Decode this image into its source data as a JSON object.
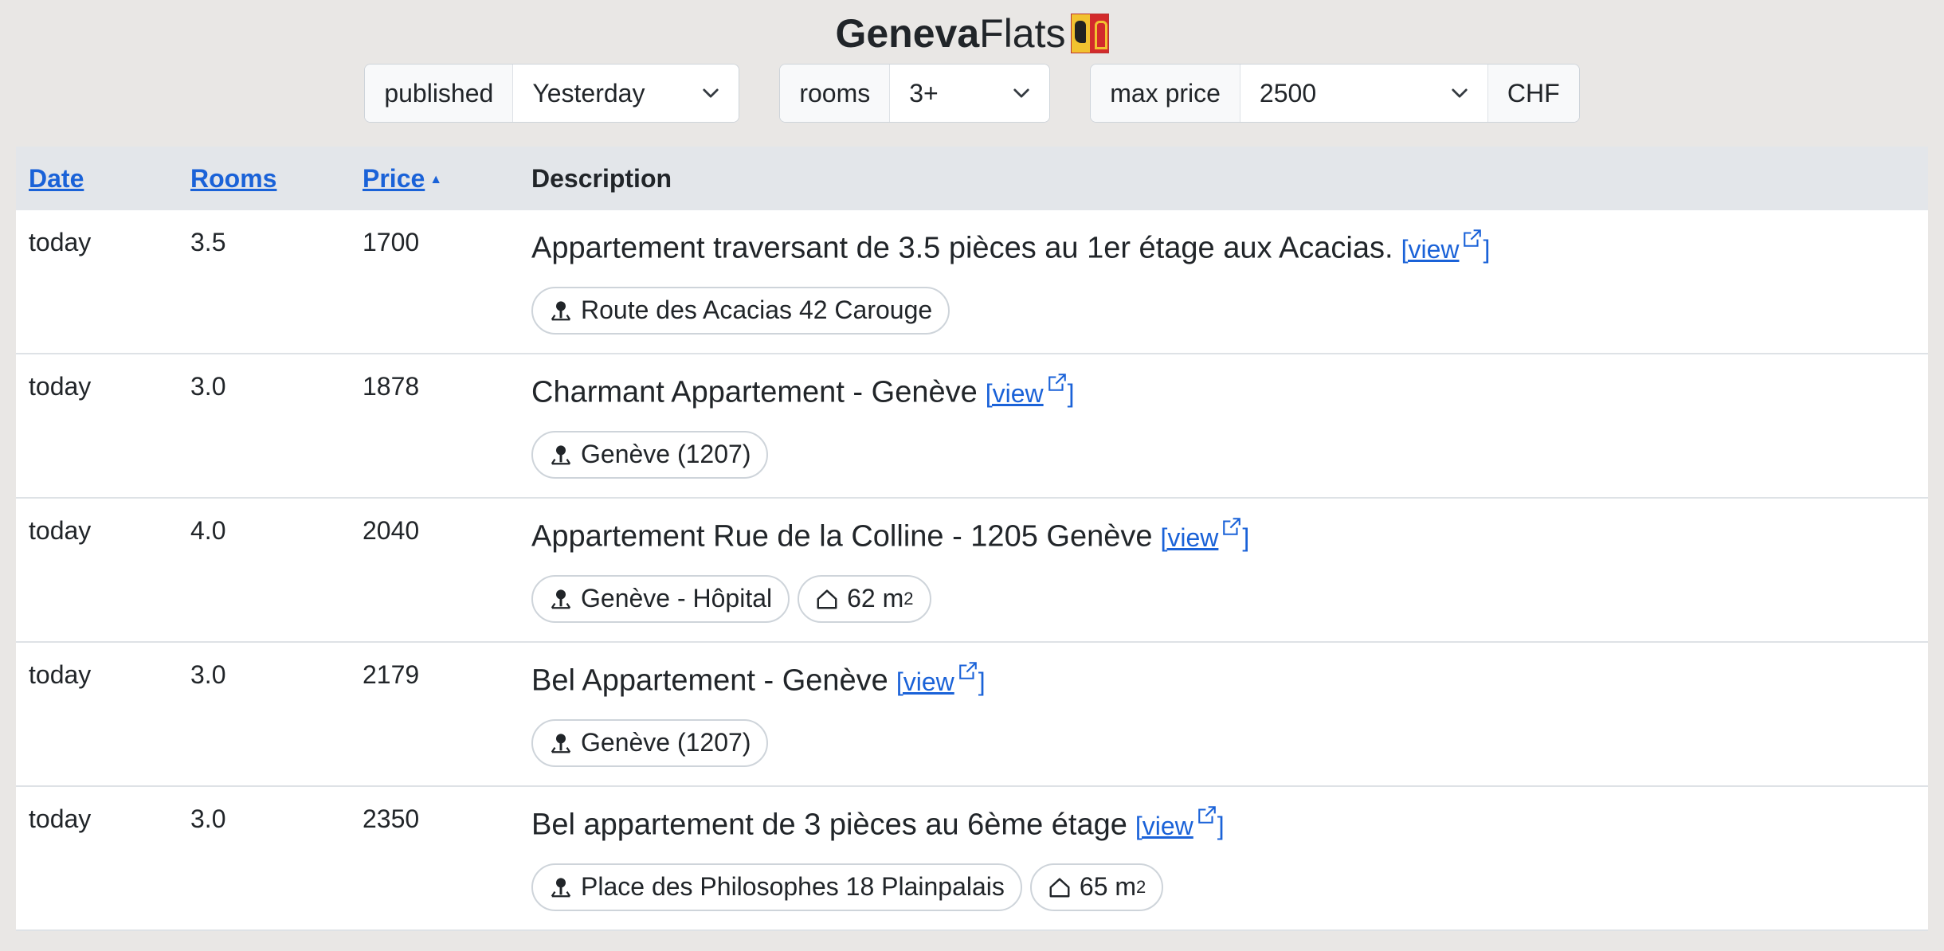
{
  "brand": {
    "bold": "Geneva",
    "light": "Flats"
  },
  "filters": {
    "published": {
      "label": "published",
      "value": "Yesterday"
    },
    "rooms": {
      "label": "rooms",
      "value": "3+"
    },
    "max_price": {
      "label": "max price",
      "value": "2500",
      "unit": "CHF"
    }
  },
  "table": {
    "headers": {
      "date": "Date",
      "rooms": "Rooms",
      "price": "Price",
      "description": "Description"
    },
    "view_text": "[view",
    "view_close": "]",
    "rows": [
      {
        "date": "today",
        "rooms": "3.5",
        "price": "1700",
        "title": "Appartement traversant de 3.5 pièces au 1er étage aux Acacias.",
        "location": "Route des Acacias 42 Carouge",
        "area": ""
      },
      {
        "date": "today",
        "rooms": "3.0",
        "price": "1878",
        "title": "Charmant Appartement - Genève",
        "location": "Genève (1207)",
        "area": ""
      },
      {
        "date": "today",
        "rooms": "4.0",
        "price": "2040",
        "title": "Appartement Rue de la Colline - 1205 Genève",
        "location": "Genève - Hôpital",
        "area": "62 m"
      },
      {
        "date": "today",
        "rooms": "3.0",
        "price": "2179",
        "title": "Bel Appartement - Genève",
        "location": "Genève (1207)",
        "area": ""
      },
      {
        "date": "today",
        "rooms": "3.0",
        "price": "2350",
        "title": "Bel appartement de 3 pièces au 6ème étage",
        "location": "Place des Philosophes 18 Plainpalais",
        "area": "65 m"
      }
    ],
    "area_sup": "2"
  }
}
